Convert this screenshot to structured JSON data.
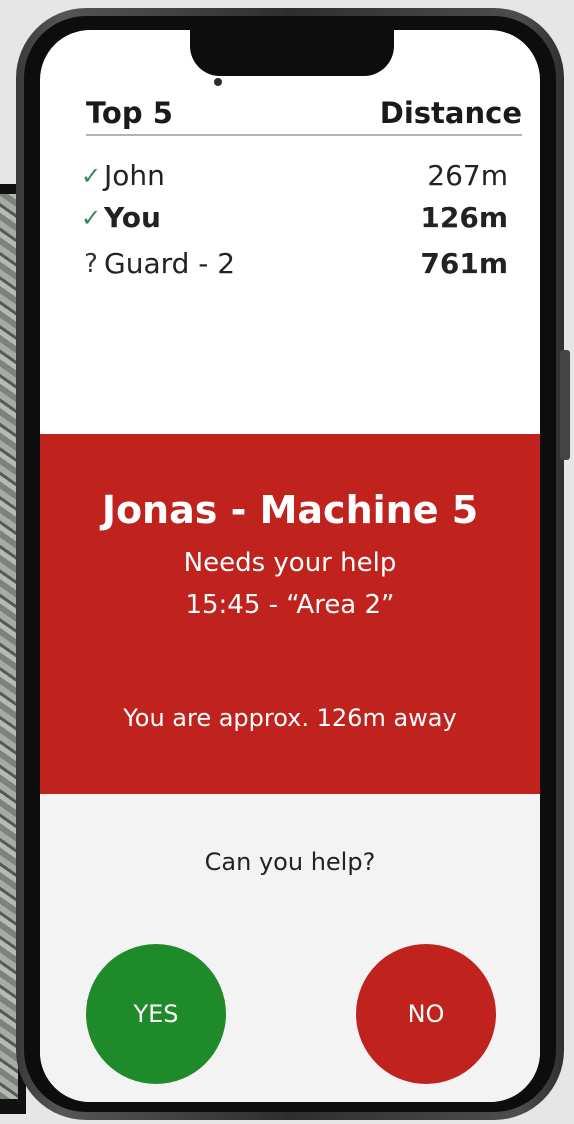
{
  "leaderboard": {
    "title": "Top 5",
    "distance_header": "Distance",
    "rows": [
      {
        "status_icon": "check-icon",
        "glyph": "✓",
        "name": "John",
        "distance": "267m",
        "bold": false
      },
      {
        "status_icon": "check-icon",
        "glyph": "✓",
        "name": "You",
        "distance": "126m",
        "bold": true
      },
      {
        "status_icon": "question-icon",
        "glyph": "?",
        "name": "Guard - 2",
        "distance": "761m",
        "bold": false
      }
    ]
  },
  "alert": {
    "title": "Jonas - Machine 5",
    "line1": "Needs your help",
    "line2": "15:45 - “Area 2”",
    "distance_note": "You are approx. 126m away",
    "background": "#c0231e"
  },
  "prompt": {
    "question": "Can you help?",
    "yes_label": "YES",
    "no_label": "NO",
    "yes_color": "#1e8a2a",
    "no_color": "#c0231e"
  }
}
